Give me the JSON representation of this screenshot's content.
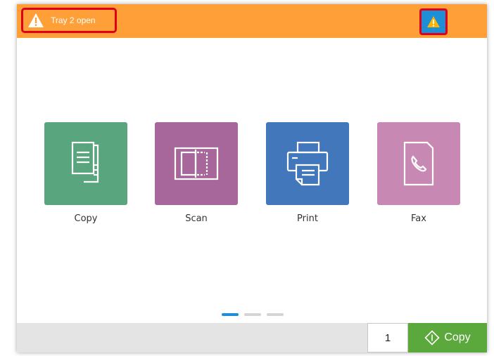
{
  "status_bar": {
    "message": "Tray 2 open",
    "warning_icon": "warning-triangle-icon",
    "alert_button_icon": "warning-triangle-icon",
    "colors": {
      "bar": "#ff9f37",
      "alert_button": "#1d8fd6",
      "highlight": "#e0001a"
    }
  },
  "apps": [
    {
      "label": "Copy",
      "icon": "copy-icon",
      "color": "#59a67e"
    },
    {
      "label": "Scan",
      "icon": "scan-icon",
      "color": "#a8679a"
    },
    {
      "label": "Print",
      "icon": "print-icon",
      "color": "#4277bb"
    },
    {
      "label": "Fax",
      "icon": "fax-icon",
      "color": "#c788b3"
    }
  ],
  "pagination": {
    "pages": 3,
    "current": 1,
    "active_color": "#1d8fd6",
    "inactive_color": "#d4d4d4"
  },
  "footer": {
    "copies_value": "1",
    "copy_button_label": "Copy",
    "copy_button_icon": "start-diamond-icon",
    "copy_button_color": "#5ba83c"
  }
}
